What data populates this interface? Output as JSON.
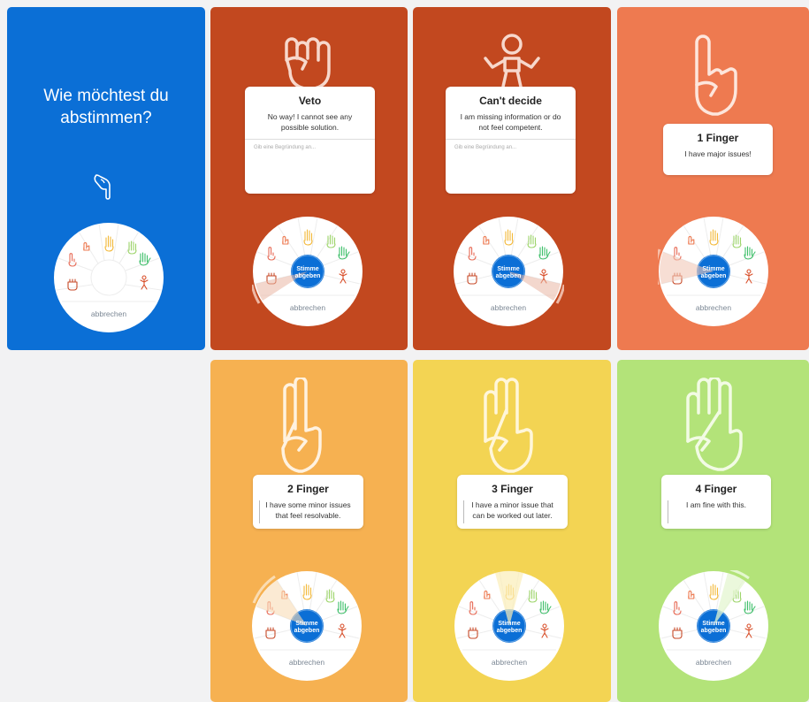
{
  "intro": {
    "prompt": "Wie möchtest du abstimmen?",
    "icon": "pointing-hand-icon"
  },
  "wheel": {
    "submit_line1": "Stimme",
    "submit_line2": "abgeben",
    "cancel_label": "abbrechen"
  },
  "options": {
    "veto": {
      "title": "Veto",
      "text": "No way! I cannot see any possible solution.",
      "placeholder": "Gib eine Begründung an..."
    },
    "cant_decide": {
      "title": "Can't decide",
      "text": "I am missing information or do not feel competent.",
      "placeholder": "Gib eine Begründung an..."
    },
    "finger1": {
      "title": "1 Finger",
      "text": "I have major issues!"
    },
    "finger2": {
      "title": "2 Finger",
      "text": "I have some minor issues that feel resolvable."
    },
    "finger3": {
      "title": "3 Finger",
      "text": "I have a minor issue that can be worked out later."
    },
    "finger4": {
      "title": "4 Finger",
      "text": "I am fine with this."
    }
  },
  "colors": {
    "intro_blue": "#0b6fd6",
    "veto": "#c2481f",
    "finger1": "#ee7a50",
    "finger2": "#f6b151",
    "finger3": "#f3d453",
    "finger4": "#b3e379",
    "submit_button": "#0b6fd6"
  }
}
